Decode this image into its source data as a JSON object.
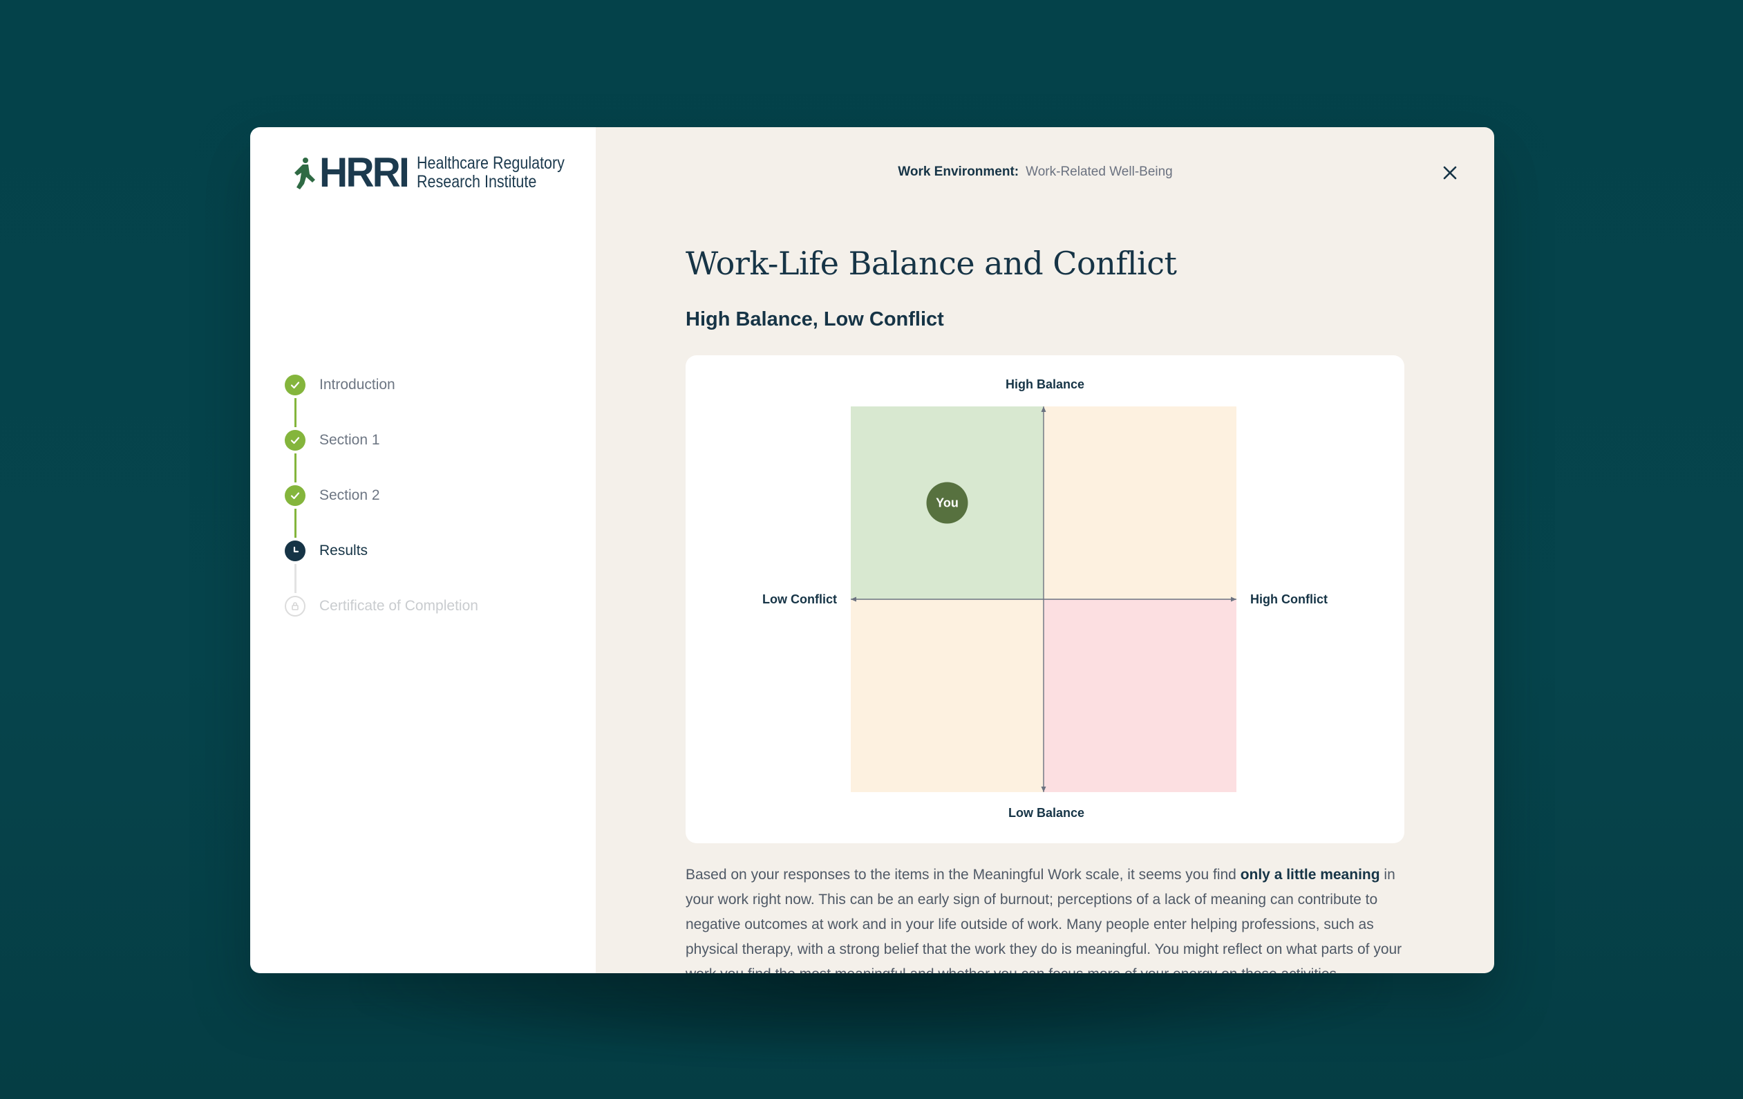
{
  "logo": {
    "mark_text": "HRRI",
    "name_line1": "Healthcare Regulatory",
    "name_line2": "Research Institute"
  },
  "sidebar": {
    "steps": [
      {
        "label": "Introduction",
        "status": "complete"
      },
      {
        "label": "Section 1",
        "status": "complete"
      },
      {
        "label": "Section 2",
        "status": "complete"
      },
      {
        "label": "Results",
        "status": "current"
      },
      {
        "label": "Certificate of Completion",
        "status": "locked"
      }
    ]
  },
  "header": {
    "category_label": "Work Environment:",
    "category_value": "Work-Related Well-Being",
    "close_icon": "close-icon"
  },
  "main": {
    "title": "Work-Life Balance and Conflict",
    "result_heading": "High Balance, Low Conflict",
    "paragraph_before": "Based on your responses to the items in the Meaningful Work scale, it seems you find ",
    "paragraph_bold": "only a little meaning",
    "paragraph_after": " in your work right now. This can be an early sign of burnout; perceptions of a lack of meaning can contribute to negative outcomes at work and in your life outside of work. Many people enter helping professions, such as physical therapy, with a strong belief that the work they do is meaningful. You might reflect on what parts of your work you find the most meaningful and whether you can focus more of your energy on those activities."
  },
  "chart_data": {
    "type": "scatter",
    "top_label": "High Balance",
    "bottom_label": "Low Balance",
    "left_label": "Low Conflict",
    "right_label": "High Conflict",
    "points": [
      {
        "label": "You",
        "conflict": -0.5,
        "balance": 0.5
      }
    ],
    "xlim": [
      -1,
      1
    ],
    "ylim": [
      -1,
      1
    ],
    "quadrants": [
      {
        "position": "top-left",
        "color": "#d8e8d0"
      },
      {
        "position": "top-right",
        "color": "#fdf1e0"
      },
      {
        "position": "bottom-left",
        "color": "#fdf1e0"
      },
      {
        "position": "bottom-right",
        "color": "#fcdfe1"
      }
    ],
    "marker_color": "#57713f"
  },
  "colors": {
    "background": "#054149",
    "complete": "#84b53c",
    "current": "#163446",
    "text_dark": "#163446"
  }
}
